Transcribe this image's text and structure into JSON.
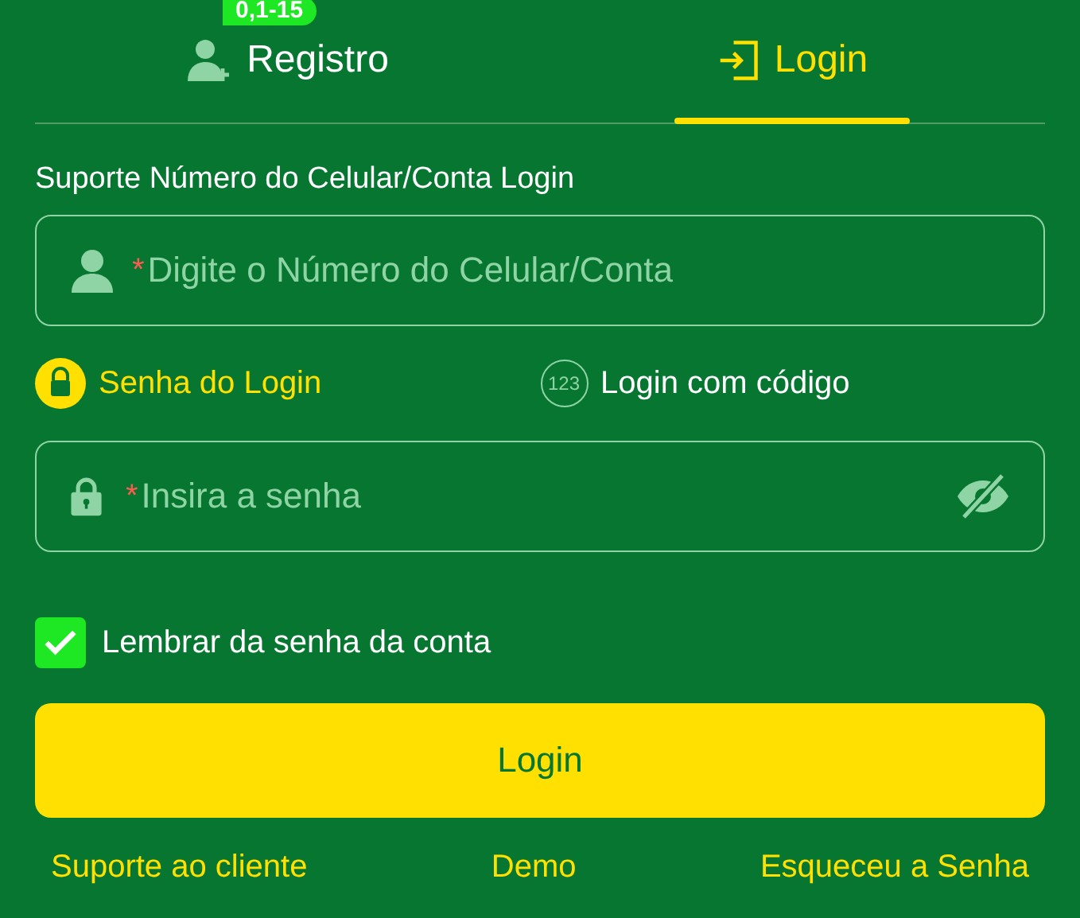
{
  "tabs": [
    {
      "label": "Registro",
      "kind": "register",
      "selected": false,
      "badge": "0,1-15"
    },
    {
      "label": "Login",
      "kind": "login",
      "selected": true
    }
  ],
  "account_label": "Suporte Número do Celular/Conta Login",
  "account_field": {
    "required_mark": "*",
    "placeholder": "Digite o Número do Celular/Conta"
  },
  "login_methods": [
    {
      "label": "Senha do Login",
      "kind": "password",
      "selected": true
    },
    {
      "label": "Login com código",
      "kind": "code",
      "selected": false,
      "icon_text": "123"
    }
  ],
  "password_field": {
    "required_mark": "*",
    "placeholder": "Insira a senha"
  },
  "remember": {
    "label": "Lembrar da senha da conta",
    "checked": true
  },
  "login_button": "Login",
  "links": [
    "Suporte ao cliente",
    "Demo",
    "Esqueceu a Senha"
  ]
}
